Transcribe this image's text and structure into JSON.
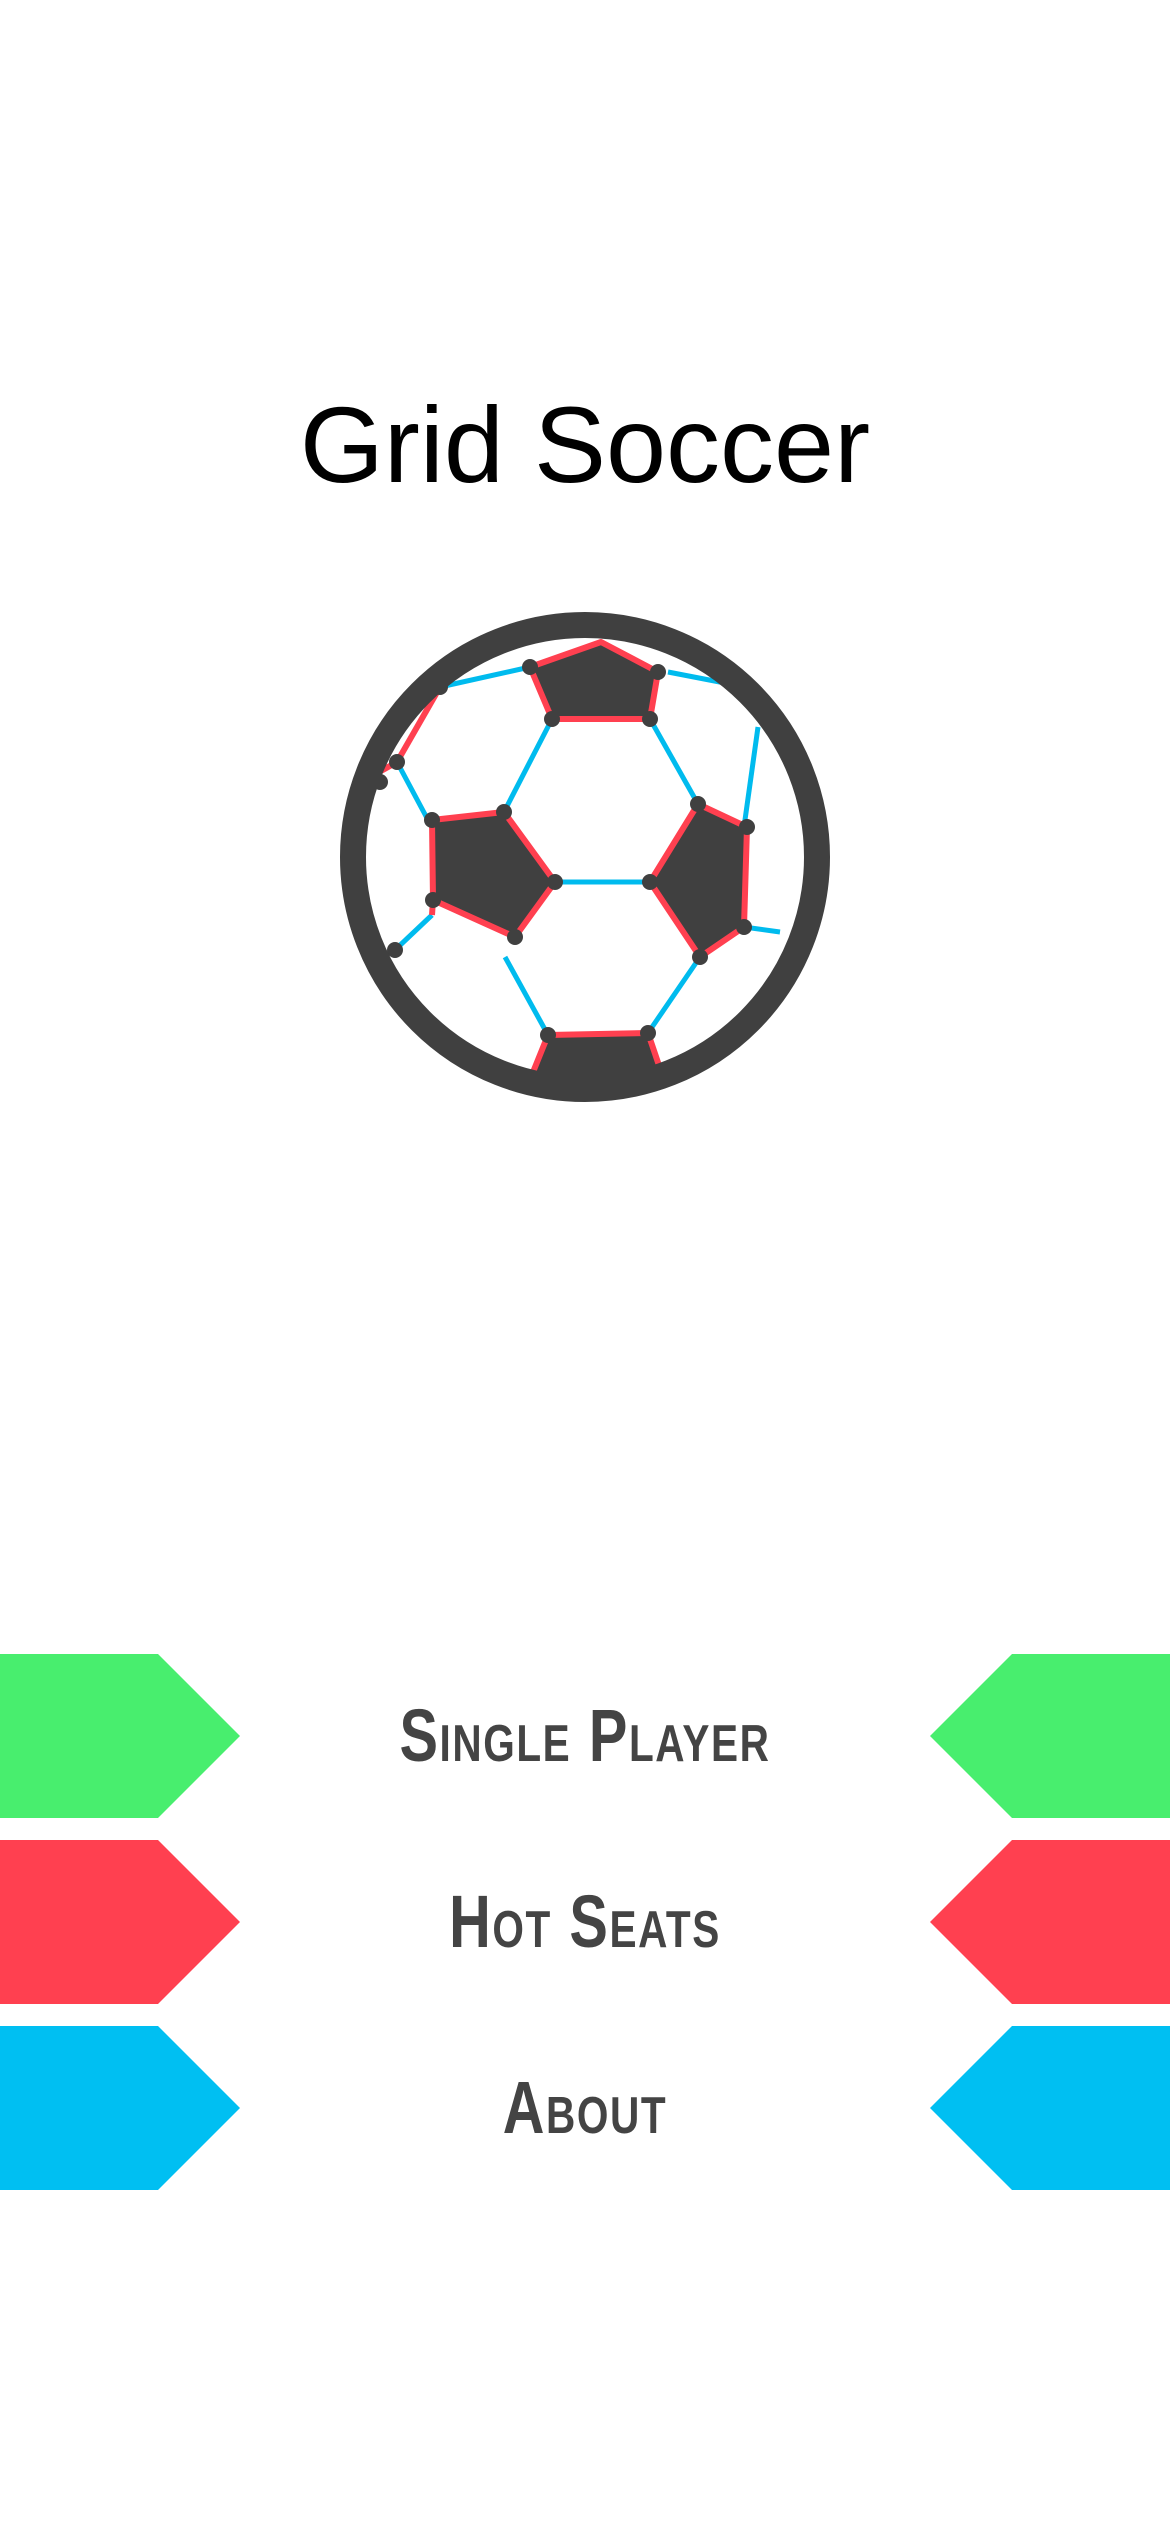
{
  "app": {
    "title": "Grid Soccer"
  },
  "logo": {
    "icon": "soccer-ball-icon",
    "colors": {
      "ball": "#404040",
      "accent_red": "#ff4050",
      "accent_blue": "#00bbee"
    }
  },
  "menu": {
    "items": [
      {
        "label": "Single Player",
        "color": "#48ee6e"
      },
      {
        "label": "Hot Seats",
        "color": "#ff4050"
      },
      {
        "label": "About",
        "color": "#00bff2"
      }
    ]
  }
}
